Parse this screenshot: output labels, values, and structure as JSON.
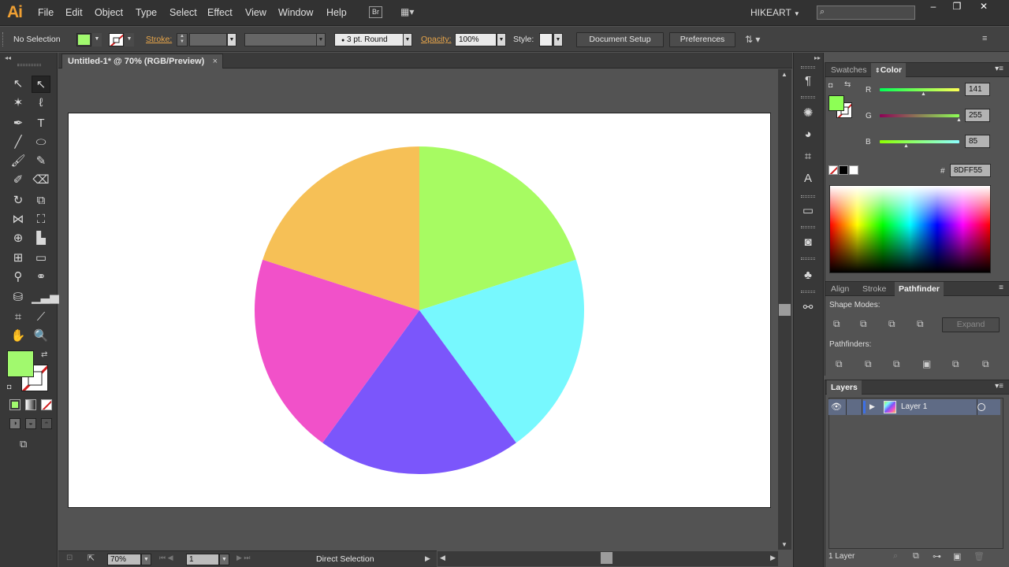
{
  "app": {
    "logo": "Ai",
    "menus": [
      "File",
      "Edit",
      "Object",
      "Type",
      "Select",
      "Effect",
      "View",
      "Window",
      "Help"
    ],
    "bridge_label": "Br",
    "workspace": "HIKEART",
    "search_placeholder": "",
    "window_controls": [
      "–",
      "❐",
      "✕"
    ]
  },
  "control_bar": {
    "selection": "No Selection",
    "stroke_label": "Stroke:",
    "brush": "3 pt. Round",
    "opacity_label": "Opacity:",
    "opacity_value": "100%",
    "style_label": "Style:",
    "document_setup": "Document Setup",
    "preferences": "Preferences",
    "fill_color": "#a1f96e"
  },
  "document": {
    "tab_title": "Untitled-1* @ 70% (RGB/Preview)",
    "close": "×"
  },
  "chart_data": {
    "type": "pie",
    "title": "",
    "slices": [
      {
        "value": 20,
        "color": "#a7fb62"
      },
      {
        "value": 20,
        "color": "#77f8fe"
      },
      {
        "value": 20,
        "color": "#7b56fb"
      },
      {
        "value": 20,
        "color": "#f151c9"
      },
      {
        "value": 20,
        "color": "#f6c056"
      }
    ],
    "start_angle_deg": 0,
    "direction": "clockwise",
    "legend": "none"
  },
  "status_bar": {
    "zoom": "70%",
    "artboard": "1",
    "tool": "Direct Selection"
  },
  "color_panel": {
    "tabs": [
      "Swatches",
      "Color"
    ],
    "active_tab": "Color",
    "r_label": "R",
    "r_value": "141",
    "g_label": "G",
    "g_value": "255",
    "b_label": "B",
    "b_value": "85",
    "hex_label": "#",
    "hex_value": "8DFF55",
    "current_color": "#8dff55"
  },
  "pathfinder_panel": {
    "tabs": [
      "Align",
      "Stroke",
      "Pathfinder"
    ],
    "active_tab": "Pathfinder",
    "shape_modes_label": "Shape Modes:",
    "expand": "Expand",
    "pathfinders_label": "Pathfinders:"
  },
  "layers_panel": {
    "title": "Layers",
    "layer_name": "Layer 1",
    "footer": "1 Layer"
  }
}
